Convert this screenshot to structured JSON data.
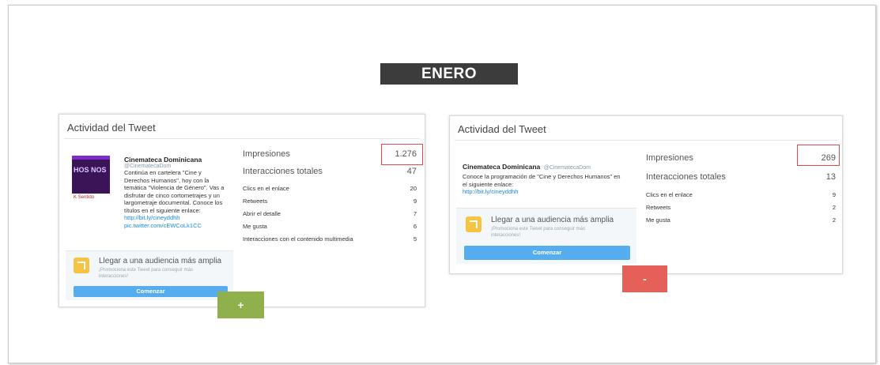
{
  "title": "ENERO",
  "cards": [
    {
      "title": "Actividad del Tweet",
      "tweet": {
        "name": "Cinemateca Dominicana",
        "handle": "@CinematecaDom",
        "text": "Continúa en cartelera \"Cine y Derechos Humanos\", hoy con la temática \"Violencia de Género\". Vas a disfrutar de cinco cortometrajes y un largometraje documental. Conoce los títulos en el siguiente enlace:",
        "link1": "http://bit.ly/cineyddhh",
        "link2": "pic.twitter.com/cEWCoLk1CC",
        "image_text": "HOS NOS",
        "image_logos": "K Sentido"
      },
      "promo": {
        "title": "Llegar a una audiencia más amplia",
        "sub": "¡Promociona este Tweet para conseguir más interacciones!",
        "button": "Comenzar"
      },
      "stats": [
        {
          "label": "Impresiones",
          "value": "1.276"
        },
        {
          "label": "Interacciones totales",
          "value": "47"
        },
        {
          "label": "Clics en el enlace",
          "value": "20"
        },
        {
          "label": "Retweets",
          "value": "9"
        },
        {
          "label": "Abrir el detalle",
          "value": "7"
        },
        {
          "label": "Me gusta",
          "value": "6"
        },
        {
          "label": "Interacciones con el contenido multimedia",
          "value": "5"
        }
      ]
    },
    {
      "title": "Actividad del Tweet",
      "tweet": {
        "name": "Cinemateca Dominicana",
        "handle": "@CinematecaDom",
        "text": "Conoce la programación de \"Cine y Derechos Humanos\" en el siguiente enlace:",
        "link1": "http://bit.ly/cineyddhh"
      },
      "promo": {
        "title": "Llegar a una audiencia más amplia",
        "sub": "¡Promociona este Tweet para conseguir más interacciones!",
        "button": "Comenzar"
      },
      "stats": [
        {
          "label": "Impresiones",
          "value": "269"
        },
        {
          "label": "Interacciones totales",
          "value": "13"
        },
        {
          "label": "Clics en el enlace",
          "value": "9"
        },
        {
          "label": "Retweets",
          "value": "2"
        },
        {
          "label": "Me gusta",
          "value": "2"
        }
      ]
    }
  ],
  "plus_label": "+",
  "minus_label": "-",
  "colors": {
    "title_bar": "#3c3c3c",
    "highlight": "#e04a4a",
    "plus": "#8fb04b",
    "minus": "#e6605a",
    "promo_button": "#55acee"
  }
}
